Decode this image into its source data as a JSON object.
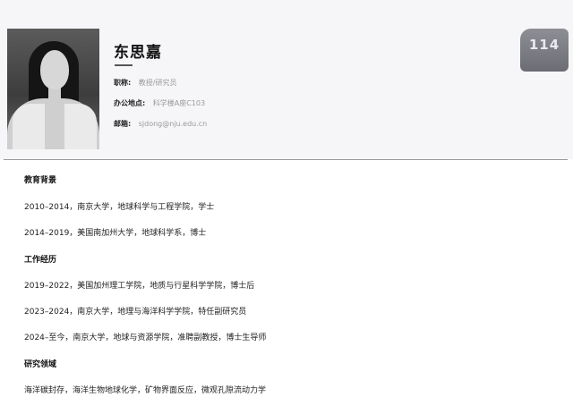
{
  "profile": {
    "name": "东思嘉",
    "title_label": "职称:",
    "title_value": "教授/研究员",
    "office_label": "办公地点:",
    "office_value": "科学楼A座C103",
    "email_label": "邮箱:",
    "email_value": "sjdong@nju.edu.cn",
    "badge": "114"
  },
  "education": {
    "heading": "教育背景",
    "items": [
      "2010–2014，南京大学，地球科学与工程学院，学士",
      "2014–2019，美国南加州大学，地球科学系，博士"
    ]
  },
  "work": {
    "heading": "工作经历",
    "items": [
      "2019–2022，美国加州理工学院，地质与行星科学学院，博士后",
      "2023–2024，南京大学，地理与海洋科学学院，特任副研究员",
      "2024–至今，南京大学，地球与资源学院，准聘副教授，博士生导师"
    ]
  },
  "research": {
    "heading": "研究领域",
    "text": "海洋碳封存，海洋生物地球化学，矿物界面反应，微观孔隙流动力学"
  }
}
